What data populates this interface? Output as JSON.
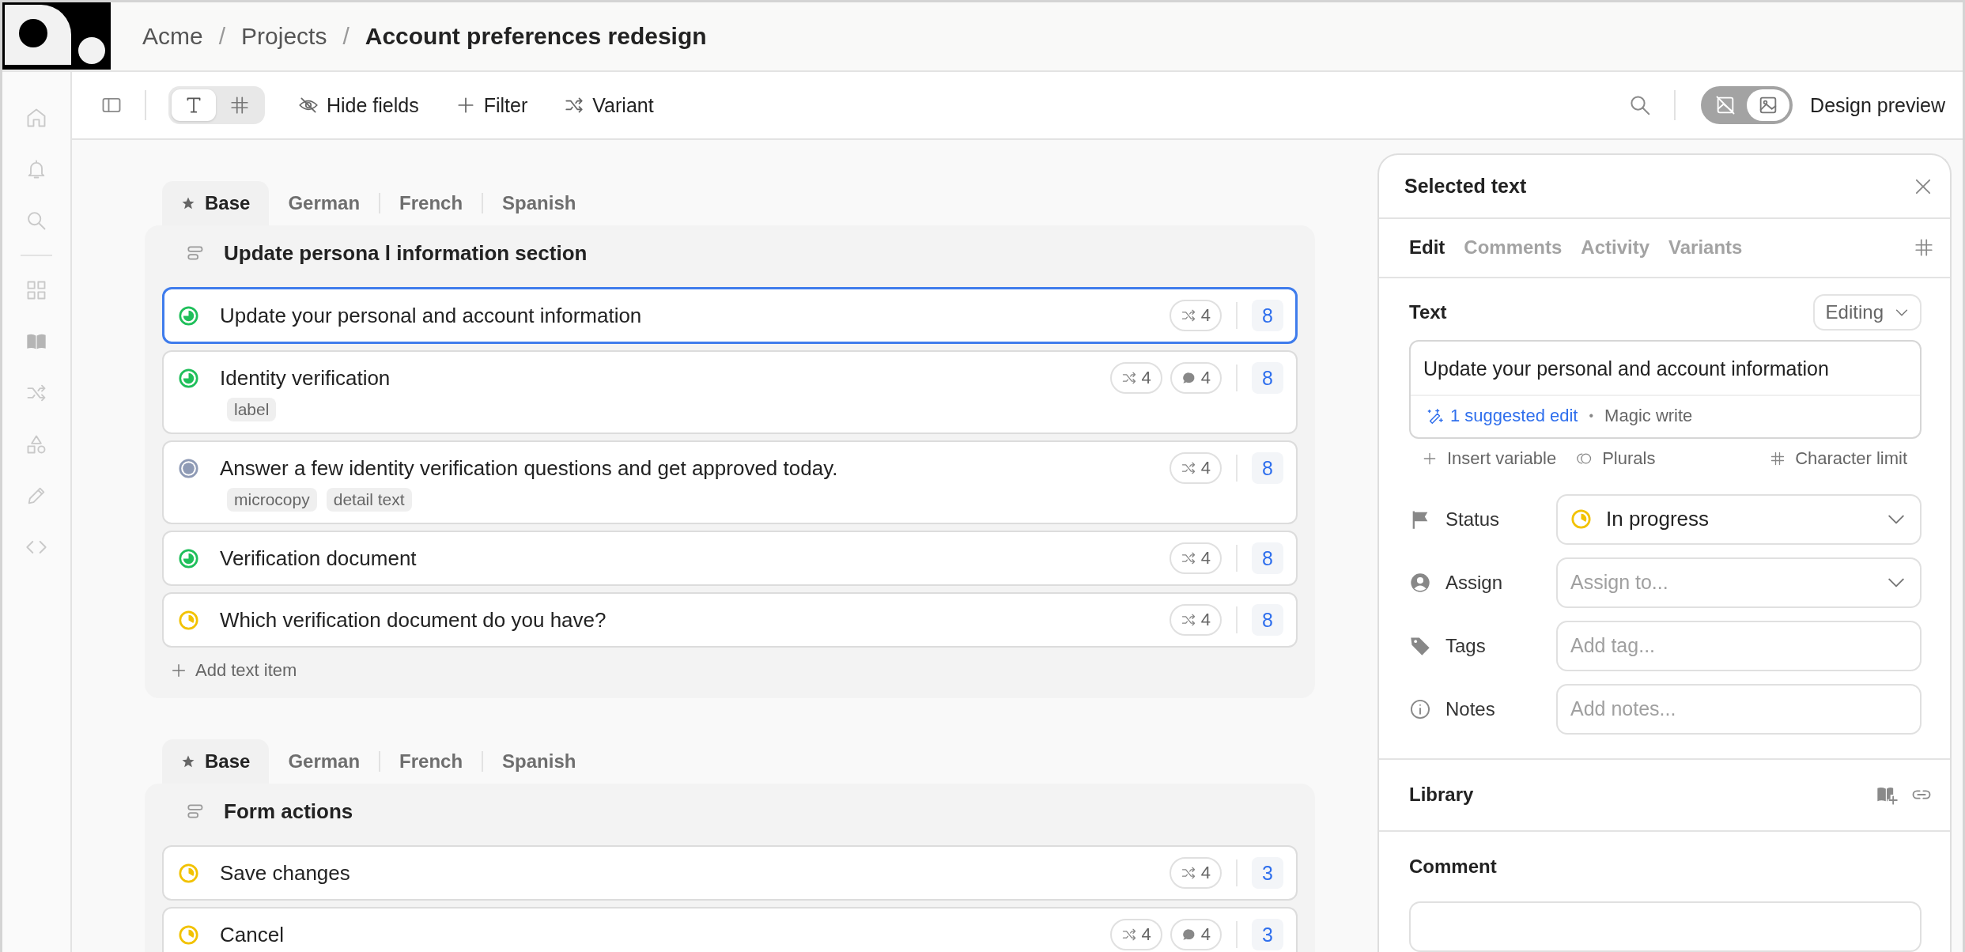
{
  "breadcrumb": [
    {
      "kind": "crumb",
      "label": "Acme"
    },
    {
      "kind": "separator",
      "label": "/"
    },
    {
      "kind": "crumb",
      "label": "Projects"
    },
    {
      "kind": "separator",
      "label": "/"
    },
    {
      "kind": "current",
      "label": "Account preferences redesign"
    }
  ],
  "toolbar": {
    "view_toggle": [
      {
        "kind": "text",
        "selected": true
      },
      {
        "kind": "grid",
        "selected": false
      }
    ],
    "actions": [
      {
        "kind": "hide",
        "label": "Hide fields"
      },
      {
        "kind": "filter",
        "label": "Filter"
      },
      {
        "kind": "variant",
        "label": "Variant"
      }
    ],
    "preview_toggle": [
      {
        "kind": "off",
        "selected": false
      },
      {
        "kind": "on",
        "selected": true
      }
    ],
    "preview_label": "Design preview"
  },
  "groups": [
    {
      "tabs": [
        {
          "label": "Base",
          "selected": true,
          "starred": true
        },
        {
          "label": "German",
          "selected": false,
          "starred": false
        },
        {
          "label": "French",
          "selected": false,
          "starred": false
        },
        {
          "label": "Spanish",
          "selected": false,
          "starred": false
        }
      ],
      "title": "Update persona l information section",
      "items": [
        {
          "text": "Update your personal and account information",
          "kind": "done",
          "selected": true,
          "variants": "4",
          "count": "8"
        },
        {
          "text": "Identity verification",
          "kind": "done",
          "selected": false,
          "tags": [
            "label"
          ],
          "variants": "4",
          "comments": "4",
          "count": "8"
        },
        {
          "text": "Answer a few identity verification questions and get approved today.",
          "kind": "review",
          "selected": false,
          "tags": [
            "microcopy",
            "detail text"
          ],
          "variants": "4",
          "count": "8"
        },
        {
          "text": "Verification document",
          "kind": "done",
          "selected": false,
          "variants": "4",
          "count": "8"
        },
        {
          "text": "Which verification document do you have?",
          "kind": "progress",
          "selected": false,
          "variants": "4",
          "count": "8"
        }
      ],
      "add_label": "Add text item"
    },
    {
      "tabs": [
        {
          "label": "Base",
          "selected": true,
          "starred": true
        },
        {
          "label": "German",
          "selected": false,
          "starred": false
        },
        {
          "label": "French",
          "selected": false,
          "starred": false
        },
        {
          "label": "Spanish",
          "selected": false,
          "starred": false
        }
      ],
      "title": "Form actions",
      "items": [
        {
          "text": "Save changes",
          "kind": "progress",
          "selected": false,
          "variants": "4",
          "count": "3"
        },
        {
          "text": "Cancel",
          "kind": "progress",
          "selected": false,
          "variants": "4",
          "comments": "4",
          "count": "3"
        }
      ]
    }
  ],
  "panel": {
    "title": "Selected text",
    "tabs": [
      {
        "label": "Edit",
        "selected": true
      },
      {
        "label": "Comments",
        "selected": false
      },
      {
        "label": "Activity",
        "selected": false
      },
      {
        "label": "Variants",
        "selected": false
      }
    ],
    "text_section": {
      "label": "Text",
      "mode": "Editing",
      "value": "Update your personal and account information",
      "suggestion": "1 suggested edit",
      "separator": "•",
      "magic": "Magic write",
      "actions": [
        {
          "kind": "variable",
          "label": "Insert variable"
        },
        {
          "kind": "plurals",
          "label": "Plurals"
        },
        {
          "kind": "limit",
          "label": "Character limit"
        }
      ]
    },
    "fields": [
      {
        "kind": "status",
        "label": "Status",
        "value": "In progress",
        "indicator": {
          "kind": "progress"
        }
      },
      {
        "kind": "assign",
        "label": "Assign",
        "placeholder": "Assign to..."
      },
      {
        "kind": "tags",
        "label": "Tags",
        "placeholder": "Add tag..."
      },
      {
        "kind": "notes",
        "label": "Notes",
        "placeholder": "Add notes..."
      }
    ],
    "library": {
      "label": "Library"
    },
    "comment": {
      "label": "Comment"
    }
  }
}
